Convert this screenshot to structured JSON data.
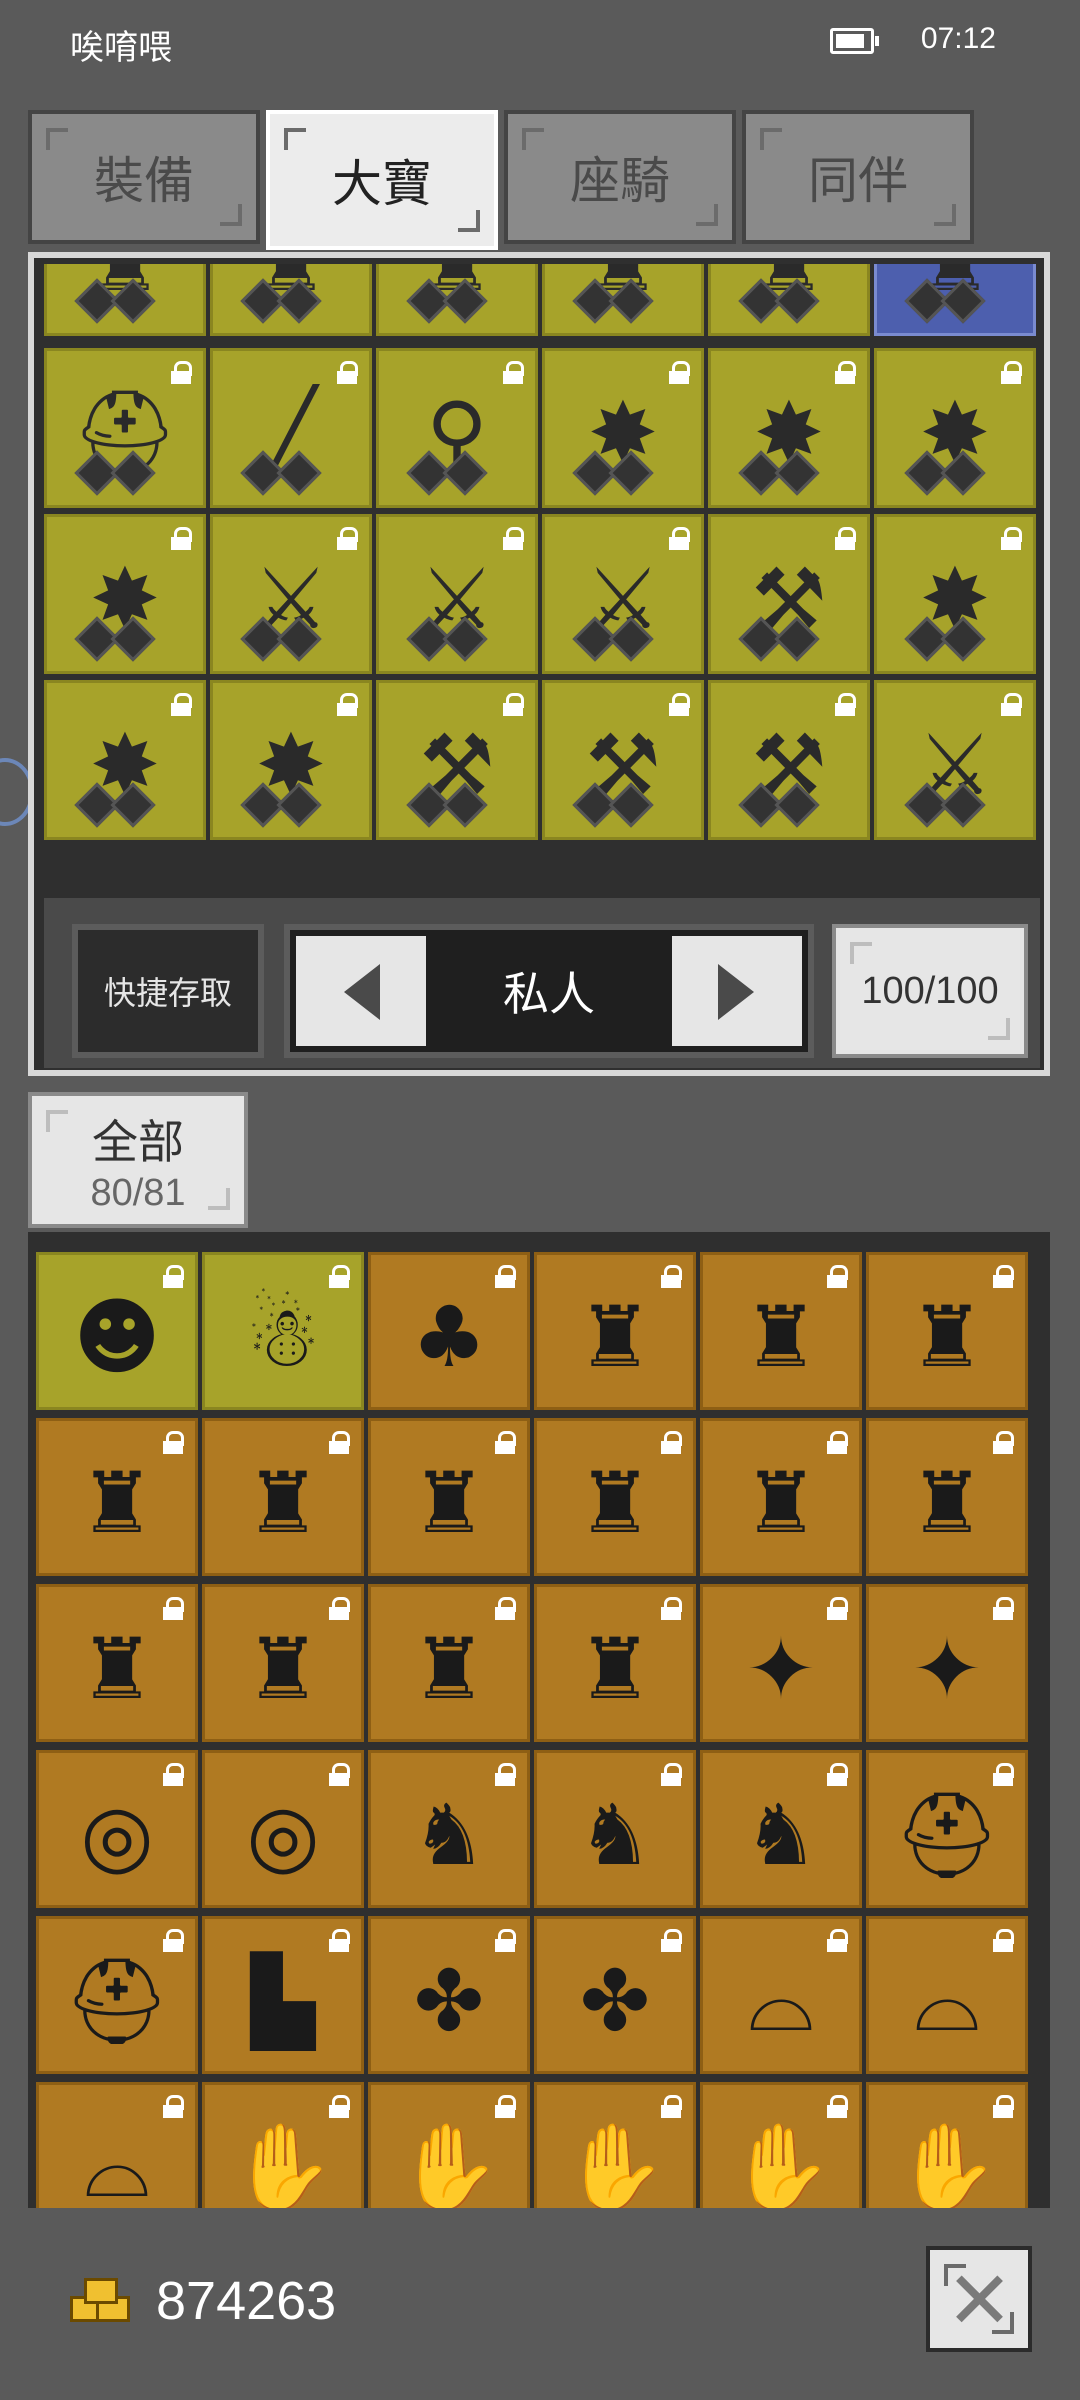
{
  "status": {
    "app": "唉唷喂",
    "time": "07:12"
  },
  "tabs": [
    {
      "label": "裝備",
      "active": false
    },
    {
      "label": "大寶",
      "active": true
    },
    {
      "label": "座騎",
      "active": false
    },
    {
      "label": "同伴",
      "active": false
    }
  ],
  "storage": {
    "quick_access": "快捷存取",
    "page_label": "私人",
    "capacity": "100/100",
    "rows": [
      [
        "armor-icon",
        "armor-icon",
        "armor-icon",
        "armor-icon",
        "armor-icon",
        "armor-icon"
      ],
      [
        "helmet-icon",
        "staff-icon",
        "wand-icon",
        "mace-icon",
        "mace-icon",
        "mace-icon"
      ],
      [
        "mace-icon",
        "sword-icon",
        "sword-icon",
        "sword-icon",
        "axe-icon",
        "mace-icon"
      ],
      [
        "mace-icon",
        "mace-icon",
        "axe-icon",
        "axe-icon",
        "axe-icon",
        "sword-icon"
      ]
    ]
  },
  "filter": {
    "label": "全部",
    "count": "80/81"
  },
  "inventory": {
    "rows": [
      [
        "pet-bear-icon",
        "pet-snowman-icon",
        "cloak-icon",
        "armor-icon",
        "armor-icon",
        "armor-icon"
      ],
      [
        "armor-icon",
        "armor-icon",
        "armor-icon",
        "armor-icon",
        "armor-icon",
        "armor-icon"
      ],
      [
        "armor-icon",
        "armor-icon",
        "armor-icon",
        "armor-icon",
        "orb-icon",
        "orb-icon"
      ],
      [
        "ring-icon",
        "ring-icon",
        "horned-helm-icon",
        "horned-helm-icon",
        "horned-helm-icon",
        "helmet-icon"
      ],
      [
        "helmet-icon",
        "boots-icon",
        "gloves-icon",
        "gloves-icon",
        "hat-icon",
        "hat-icon"
      ],
      [
        "hat-icon",
        "gauntlet-icon",
        "gauntlet-icon",
        "gauntlet-icon",
        "gauntlet-icon",
        "gauntlet-icon"
      ]
    ]
  },
  "gold": "874263",
  "glyphs": {
    "armor-icon": "♜",
    "helmet-icon": "⛑",
    "staff-icon": "╱",
    "wand-icon": "⚲",
    "mace-icon": "✸",
    "sword-icon": "⚔",
    "axe-icon": "⚒",
    "pet-bear-icon": "☻",
    "pet-snowman-icon": "☃",
    "cloak-icon": "♣",
    "orb-icon": "✦",
    "ring-icon": "◎",
    "horned-helm-icon": "♞",
    "boots-icon": "▙",
    "gloves-icon": "✤",
    "hat-icon": "⌓",
    "gauntlet-icon": "✋"
  },
  "colors": {
    "item_cell": "#a7a32a",
    "inventory_cell": "#b07a22",
    "selected_cell": "#4d5fae"
  }
}
